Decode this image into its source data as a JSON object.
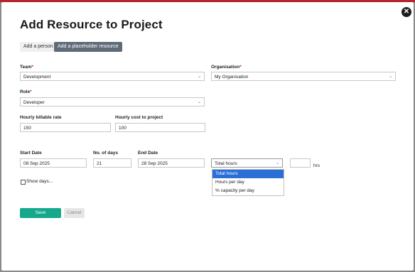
{
  "modal": {
    "title": "Add Resource to Project",
    "close_icon": "close-icon"
  },
  "tabs": [
    {
      "label": "Add a person",
      "active": false
    },
    {
      "label": "Add a placeholder resource",
      "active": true
    }
  ],
  "form": {
    "team": {
      "label": "Team",
      "value": "Development"
    },
    "organisation": {
      "label": "Organisation",
      "value": "My Organisation"
    },
    "role": {
      "label": "Role",
      "value": "Developer"
    },
    "billable_rate": {
      "label": "Hourly billable rate",
      "value": "150"
    },
    "cost_rate": {
      "label": "Hourly cost to project",
      "value": "100"
    },
    "start_date": {
      "label": "Start Date",
      "value": "08 Sep 2025"
    },
    "num_days": {
      "label": "No. of days",
      "value": "21"
    },
    "end_date": {
      "label": "End Date",
      "value": "28 Sep 2025"
    },
    "allocation_type": {
      "value": "Total hours",
      "options": [
        "Total hours",
        "Hours per day",
        "% capacity per day"
      ]
    },
    "hours_value": "",
    "hours_unit": "hrs",
    "show_days": {
      "label": "Show days...",
      "checked": false
    },
    "required_marker": "*"
  },
  "buttons": {
    "save": "Save",
    "cancel": "Cancel"
  },
  "colors": {
    "accent_save": "#16a88a",
    "tab_active": "#5f6b77",
    "dropdown_selected": "#2a6fd6",
    "required": "#c0272d"
  }
}
